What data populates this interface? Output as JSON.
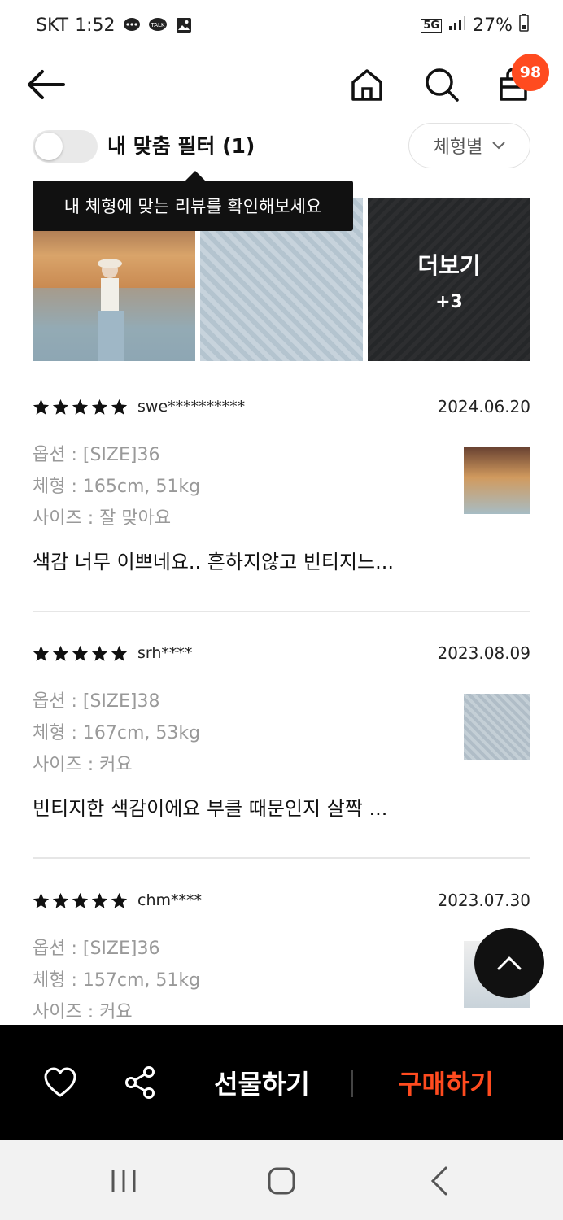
{
  "status_bar": {
    "carrier": "SKT",
    "time": "1:52",
    "network": "5G",
    "battery": "27%"
  },
  "header": {
    "cart_badge": "98",
    "icons": [
      "back-arrow-icon",
      "home-icon",
      "search-icon",
      "cart-icon"
    ]
  },
  "filter": {
    "label": "내 맞춤 필터 (1)",
    "toggle_on": false,
    "body_type_select": "체형별"
  },
  "tooltip": "내 체형에 맞는 리뷰를 확인해보세요",
  "photos": {
    "more_label": "더보기",
    "more_count": "+3"
  },
  "reviews": [
    {
      "rating": 5,
      "reviewer": "swe**********",
      "date": "2024.06.20",
      "option": "옵션 : [SIZE]36",
      "body": "체형 : 165cm, 51kg",
      "size": "사이즈 : 잘 맞아요",
      "text": "색감 너무 이쁘네요.. 흔하지않고 빈티지느..."
    },
    {
      "rating": 5,
      "reviewer": "srh****",
      "date": "2023.08.09",
      "option": "옵션 : [SIZE]38",
      "body": "체형 : 167cm, 53kg",
      "size": "사이즈 : 커요",
      "text": "빈티지한 색감이에요 부클 때문인지 살짝 ..."
    },
    {
      "rating": 5,
      "reviewer": "chm****",
      "date": "2023.07.30",
      "option": "옵션 : [SIZE]36",
      "body": "체형 : 157cm, 51kg",
      "size": "사이즈 : 커요",
      "text": ""
    }
  ],
  "bottom_bar": {
    "gift_label": "선물하기",
    "buy_label": "구매하기"
  },
  "colors": {
    "accent": "#ff4b1f",
    "bar_bg": "#000000"
  }
}
